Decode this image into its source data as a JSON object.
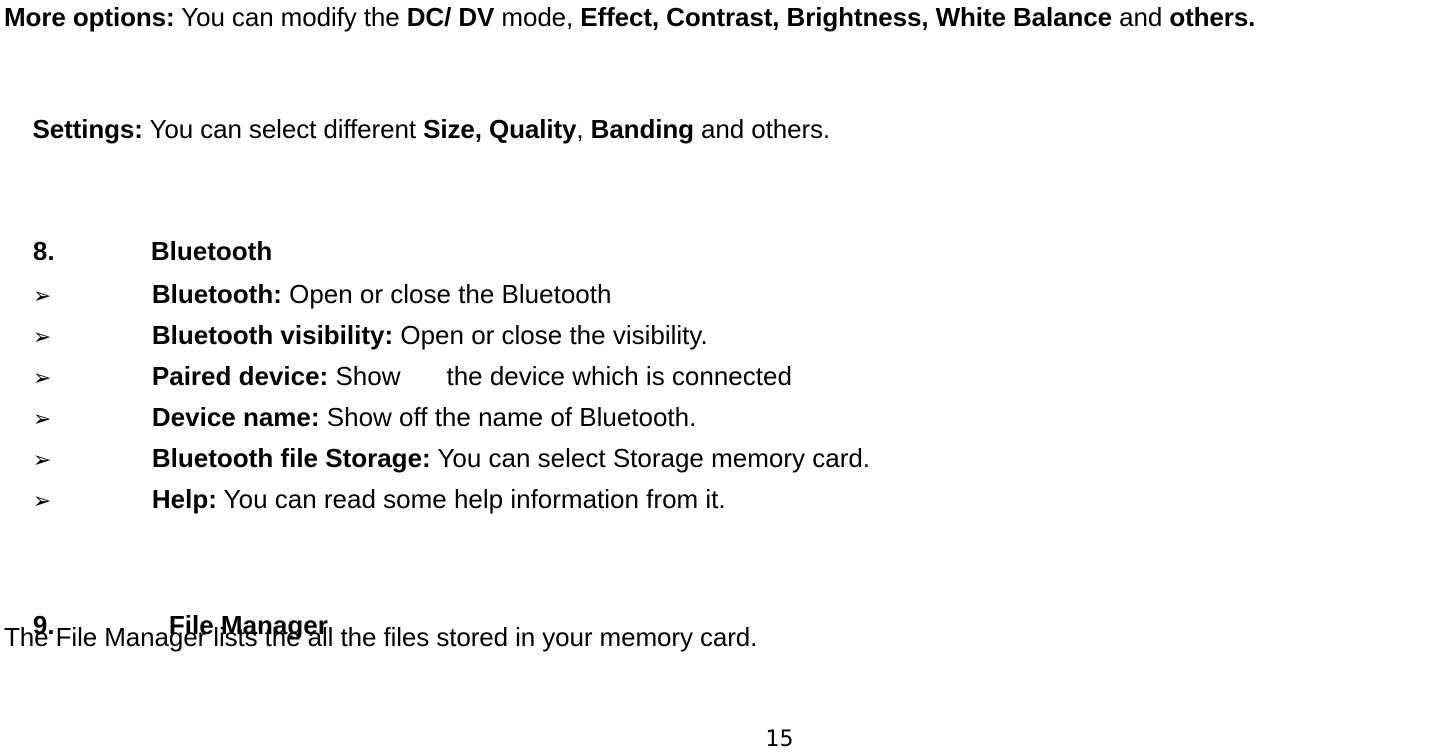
{
  "document": {
    "page_number": "15",
    "intro_paragraphs": [
      {
        "label": "More options:",
        "segments": [
          {
            "text": "More options:",
            "bold": true
          },
          {
            "text": " You can modify the ",
            "bold": false
          },
          {
            "text": "DC/ DV",
            "bold": true
          },
          {
            "text": " mode, ",
            "bold": false
          },
          {
            "text": "Effect, Contrast, Brightness, White Balance",
            "bold": true
          },
          {
            "text": " and ",
            "bold": false
          },
          {
            "text": "others.",
            "bold": true
          }
        ],
        "plain_text": "More options: You can modify the DC/ DV mode, Effect, Contrast, Brightness, White Balance and others."
      },
      {
        "label": "Settings:",
        "segments": [
          {
            "text": "Settings:",
            "bold": true
          },
          {
            "text": " You can select different ",
            "bold": false
          },
          {
            "text": "Size, Quality",
            "bold": true
          },
          {
            "text": ", ",
            "bold": false
          },
          {
            "text": "Banding",
            "bold": true
          },
          {
            "text": " and others.",
            "bold": false
          }
        ],
        "plain_text": "Settings: You can select different Size, Quality, Banding and others."
      }
    ],
    "sections": [
      {
        "number": "8.",
        "title": "Bluetooth",
        "bullet_glyph": "➢",
        "bullets": [
          {
            "term": "Bluetooth:",
            "description": " Open or close the Bluetooth"
          },
          {
            "term": "Bluetooth visibility:",
            "description": " Open or close the visibility."
          },
          {
            "term": "Paired device:",
            "description_before_gap": " Show",
            "description_after_gap": "the device which is connected"
          },
          {
            "term": "Device name:",
            "description": " Show off the name of Bluetooth."
          },
          {
            "term": "Bluetooth file Storage:",
            "description": " You can select Storage memory card."
          },
          {
            "term": "Help:",
            "description": " You can read some help information from it."
          }
        ]
      },
      {
        "number": "9.",
        "title": "File Manager",
        "body": "The File Manager lists the all the files stored in your memory card."
      }
    ]
  }
}
